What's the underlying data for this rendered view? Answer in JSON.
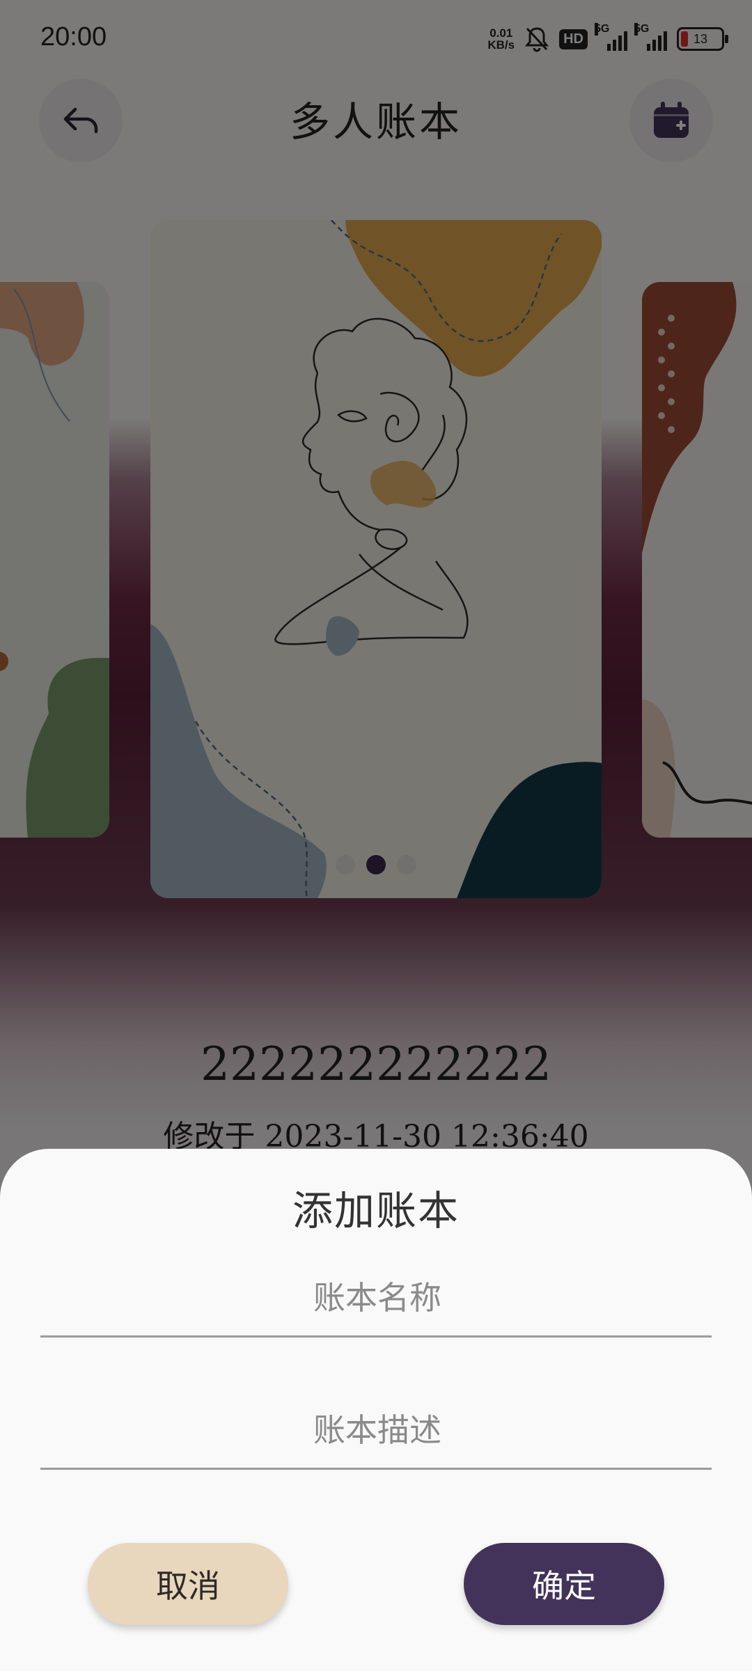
{
  "status_bar": {
    "time": "20:00",
    "net_speed_value": "0.01",
    "net_speed_unit": "KB/s",
    "hd_label": "HD",
    "sim1_label": "5G",
    "sim2_label": "5G",
    "battery": "13"
  },
  "header": {
    "title": "多人账本"
  },
  "carousel": {
    "book_name": "222222222222",
    "modified": "修改于 2023-11-30 12:36:40",
    "page_count": 3,
    "active_page": 2
  },
  "dialog": {
    "title": "添加账本",
    "name_placeholder": "账本名称",
    "desc_placeholder": "账本描述",
    "cancel_label": "取消",
    "confirm_label": "确定"
  },
  "colors": {
    "primary": "#433259",
    "secondary": "#e8d6bd",
    "accent_band": "#5a1f38"
  },
  "icons": {
    "back": "back-arrow-icon",
    "calendar": "calendar-add-icon"
  }
}
